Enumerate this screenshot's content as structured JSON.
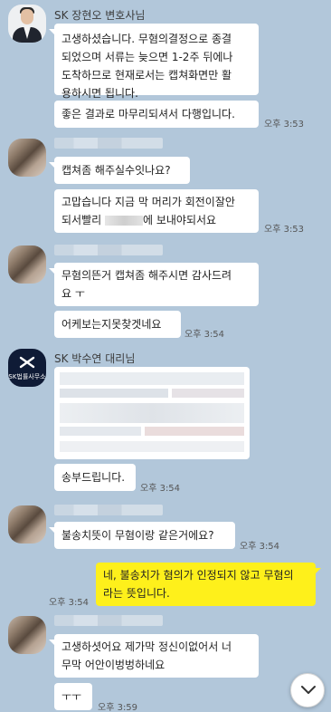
{
  "chat": {
    "messages": [
      {
        "sender": "SK 장현오 변호사님",
        "bubbles": [
          {
            "lines": [
              "고생하셨습니다. 무혐의결정으로 종결",
              "되었으며 서류는 늦으면 1-2주 뒤에나",
              "도착하므로 현재로서는 캡쳐화면만 활",
              "용하시면 됩니다."
            ]
          },
          {
            "lines": [
              "좋은 결과로 마무리되셔서 다행입니다."
            ],
            "time": "오후 3:53"
          }
        ]
      },
      {
        "bubbles": [
          {
            "lines": [
              "캡쳐좀 해주실수잇나요?"
            ]
          },
          {
            "line1": "고맙습니다 지금 막 머리가 회전이잘안",
            "line2_before": "되서빨리",
            "line2_after": "에 보내야되서요",
            "time": "오후 3:53"
          }
        ]
      },
      {
        "bubbles": [
          {
            "lines": [
              "무혐의뜬거 캡쳐좀 해주시면 감사드려",
              "요 ㅜ"
            ]
          },
          {
            "lines": [
              "어케보는지못찾겟네요"
            ],
            "time": "오후 3:54"
          }
        ]
      },
      {
        "sender": "SK 박수연 대리님",
        "avatar_label": "SK법률사무소",
        "bubbles": [
          {
            "lines": [
              "송부드립니다."
            ],
            "time": "오후 3:54"
          }
        ]
      },
      {
        "bubbles": [
          {
            "lines": [
              "불송치뜻이 무혐이랑 같은거에요?"
            ],
            "time": "오후 3:54"
          }
        ]
      },
      {
        "mine": true,
        "bubbles": [
          {
            "lines": [
              "네, 불송치가 혐의가 인정되지 않고 무혐의",
              "라는 뜻입니다."
            ],
            "time": "오후 3:54"
          }
        ]
      },
      {
        "bubbles": [
          {
            "lines": [
              "고생하셧어요 제가막 정신이없어서 너",
              "무막 어안이벙벙하네요"
            ]
          },
          {
            "lines": [
              "ㅜㅜ"
            ],
            "time": "오후 3:59"
          }
        ]
      }
    ],
    "icons": {
      "lawyer_avatar": "lawyer-avatar-icon",
      "sk_logo": "sk-logo-icon",
      "scroll_down": "chevron-down-icon"
    },
    "colors": {
      "background": "#b2c7da",
      "incoming_bubble": "#ffffff",
      "outgoing_bubble": "#fef01b"
    }
  }
}
